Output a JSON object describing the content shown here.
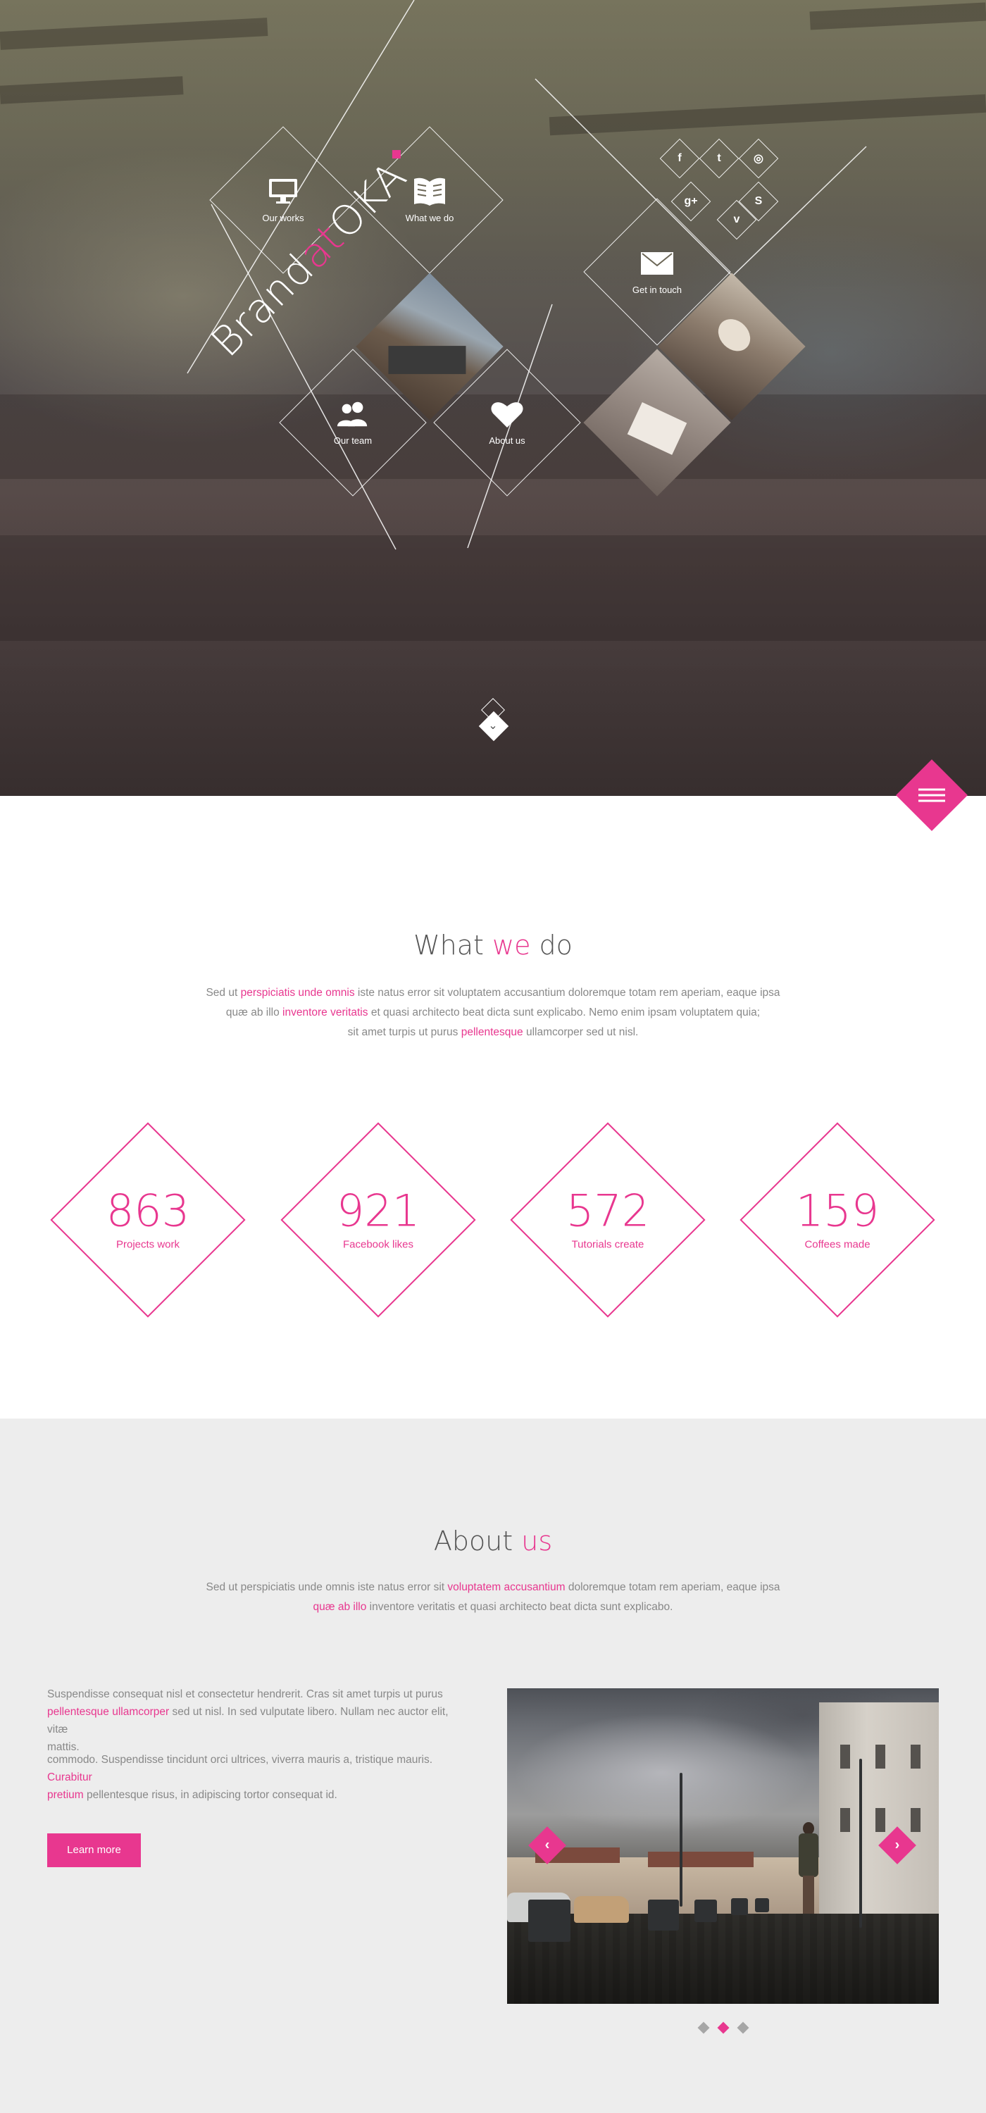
{
  "hero": {
    "brand": {
      "part1": "Brand",
      "part2": "at",
      "part3": "OKA"
    },
    "tiles": [
      {
        "label": "Our works",
        "icon": "monitor-icon"
      },
      {
        "label": "What we do",
        "icon": "book-icon"
      },
      {
        "label": "Our team",
        "icon": "users-icon"
      },
      {
        "label": "About us",
        "icon": "heart-icon"
      },
      {
        "label": "Get in touch",
        "icon": "envelope-icon"
      }
    ],
    "social": [
      {
        "name": "facebook-icon",
        "glyph": "f"
      },
      {
        "name": "twitter-icon",
        "glyph": "t"
      },
      {
        "name": "dribbble-icon",
        "glyph": "◎"
      },
      {
        "name": "google-plus-icon",
        "glyph": "g+"
      },
      {
        "name": "vimeo-icon",
        "glyph": "v"
      },
      {
        "name": "skype-icon",
        "glyph": "S"
      }
    ],
    "scroll_glyph": "⌄"
  },
  "what_we_do": {
    "title_a": "What ",
    "title_b": "we",
    "title_c": " do",
    "p": [
      {
        "t": "Sed ut ",
        "pink": false
      },
      {
        "t": "perspiciatis unde omnis",
        "pink": true
      },
      {
        "t": " iste natus error sit voluptatem accusantium doloremque totam rem aperiam, eaque ipsa",
        "pink": false
      },
      {
        "t": "\n",
        "pink": false
      },
      {
        "t": "quæ ab illo ",
        "pink": false
      },
      {
        "t": "inventore veritatis",
        "pink": true
      },
      {
        "t": " et quasi architecto beat dicta sunt explicabo. Nemo enim ipsam voluptatem quia;",
        "pink": false
      },
      {
        "t": "\n",
        "pink": false
      },
      {
        "t": "sit amet turpis ut purus ",
        "pink": false
      },
      {
        "t": "pellentesque",
        "pink": true
      },
      {
        "t": " ullamcorper sed ut nisl.",
        "pink": false
      }
    ],
    "stats": [
      {
        "value": "863",
        "caption": "Projects work"
      },
      {
        "value": "921",
        "caption": "Facebook likes"
      },
      {
        "value": "572",
        "caption": "Tutorials create"
      },
      {
        "value": "159",
        "caption": "Coffees made"
      }
    ]
  },
  "about": {
    "title_a": "About ",
    "title_b": "us",
    "p": [
      {
        "t": "Sed ut perspiciatis unde omnis iste natus error sit ",
        "pink": false
      },
      {
        "t": "voluptatem accusantium",
        "pink": true
      },
      {
        "t": " doloremque totam rem aperiam, eaque ipsa",
        "pink": false
      },
      {
        "t": "\n",
        "pink": false
      },
      {
        "t": "quæ ab illo",
        "pink": true
      },
      {
        "t": " inventore veritatis et quasi architecto beat dicta sunt explicabo.",
        "pink": false
      }
    ],
    "copy1": [
      {
        "t": "Suspendisse consequat nisl et consectetur hendrerit. Cras sit amet turpis ut purus",
        "pink": false
      },
      {
        "t": "\n",
        "pink": false
      },
      {
        "t": "pellentesque ullamcorper",
        "pink": true
      },
      {
        "t": " sed ut nisl. In sed vulputate libero. Nullam nec auctor elit, vitæ",
        "pink": false
      },
      {
        "t": "\n",
        "pink": false
      },
      {
        "t": "mattis.",
        "pink": false
      }
    ],
    "copy2": [
      {
        "t": "commodo. Suspendisse tincidunt orci ultrices, viverra mauris a, tristique mauris. ",
        "pink": false
      },
      {
        "t": "Curabitur",
        "pink": true
      },
      {
        "t": "\n",
        "pink": false
      },
      {
        "t": "pretium",
        "pink": true
      },
      {
        "t": " pellentesque risus, in adipiscing tortor consequat id.",
        "pink": false
      }
    ],
    "button": "Learn more",
    "slider": {
      "prev": "‹",
      "next": "›",
      "slides": 3,
      "active": 2
    }
  },
  "colors": {
    "accent": "#e8378f",
    "gray_bg": "#ededed",
    "text": "#888888"
  }
}
